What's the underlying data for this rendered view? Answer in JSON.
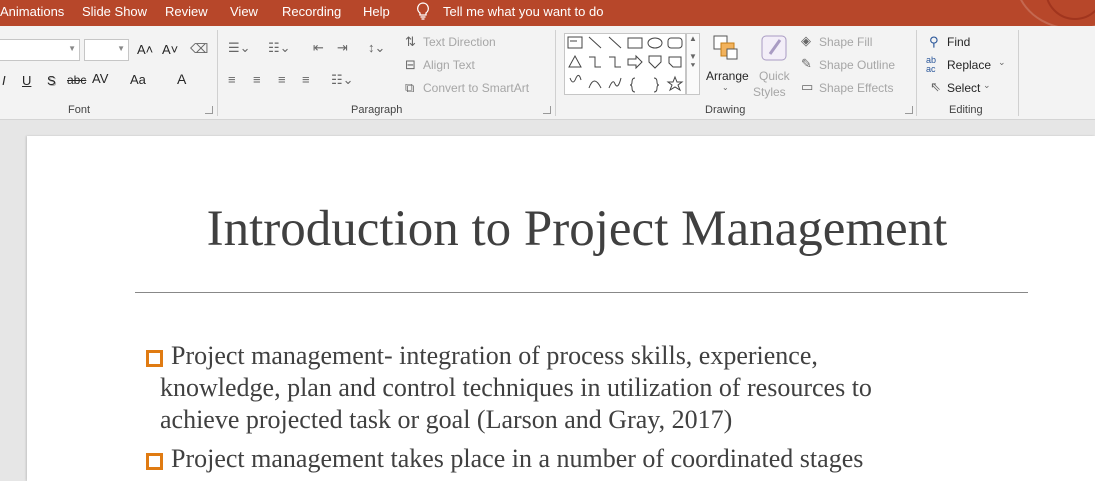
{
  "tabs": [
    "Animations",
    "Slide Show",
    "Review",
    "View",
    "Recording",
    "Help"
  ],
  "tell_me": "Tell me what you want to do",
  "ribbon": {
    "font": {
      "label": "Font",
      "grow": "A˄",
      "shrink": "A˅",
      "italic": "I",
      "underline": "U",
      "shadow": "S",
      "strike": "abc",
      "spacing": "AV",
      "case": "Aa",
      "color": "A"
    },
    "paragraph": {
      "label": "Paragraph",
      "text_direction": "Text Direction",
      "align_text": "Align Text",
      "convert_smartart": "Convert to SmartArt"
    },
    "drawing": {
      "label": "Drawing",
      "arrange": "Arrange",
      "quick_styles_1": "Quick",
      "quick_styles_2": "Styles",
      "shape_fill": "Shape Fill",
      "shape_outline": "Shape Outline",
      "shape_effects": "Shape Effects"
    },
    "editing": {
      "label": "Editing",
      "find": "Find",
      "replace": "Replace",
      "select": "Select"
    }
  },
  "slide": {
    "title": "Introduction to Project Management",
    "bullets": [
      {
        "lines": [
          "Project management- integration of process skills, experience,",
          "knowledge, plan and control techniques in utilization of resources to",
          "achieve projected task or goal (Larson and Gray, 2017)"
        ]
      },
      {
        "lines": [
          "Project management takes place in a number of coordinated stages"
        ]
      }
    ]
  },
  "colors": {
    "accent": "#b7472a",
    "bullet": "#e07b12"
  }
}
